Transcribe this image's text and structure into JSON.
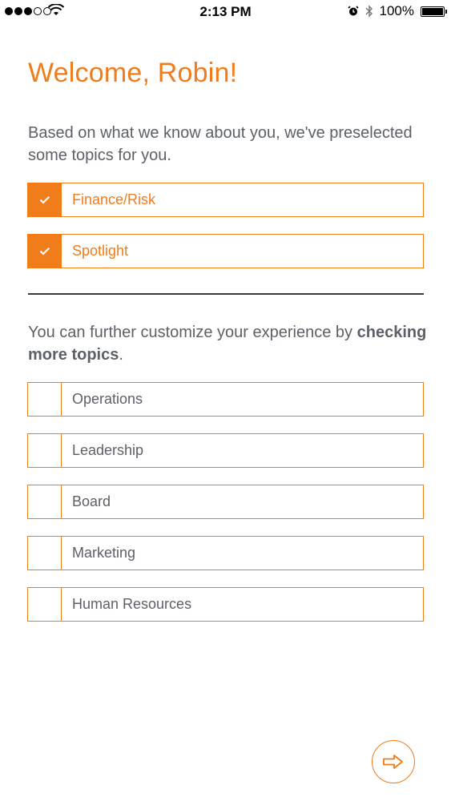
{
  "status_bar": {
    "time": "2:13 PM",
    "battery_percent": "100%",
    "signal_dots_filled": 3,
    "icons": [
      "signal-dots-icon",
      "wifi-icon",
      "alarm-icon",
      "bluetooth-icon",
      "battery-icon"
    ]
  },
  "header": {
    "title": "Welcome, Robin!"
  },
  "intro": {
    "text": "Based on what we know about you, we've preselected some topics for you."
  },
  "preselected_topics": [
    {
      "label": "Finance/Risk",
      "checked": true
    },
    {
      "label": "Spotlight",
      "checked": true
    }
  ],
  "customize": {
    "text_before": "You can further customize your experience by ",
    "text_bold": "checking more topics",
    "text_after": "."
  },
  "more_topics": [
    {
      "label": "Operations",
      "checked": false
    },
    {
      "label": "Leadership",
      "checked": false
    },
    {
      "label": "Board",
      "checked": false
    },
    {
      "label": "Marketing",
      "checked": false
    },
    {
      "label": "Human Resources",
      "checked": false
    }
  ],
  "next_button": {
    "icon": "arrow-right-icon"
  },
  "colors": {
    "accent": "#f07c1a",
    "text": "#5c6168"
  }
}
